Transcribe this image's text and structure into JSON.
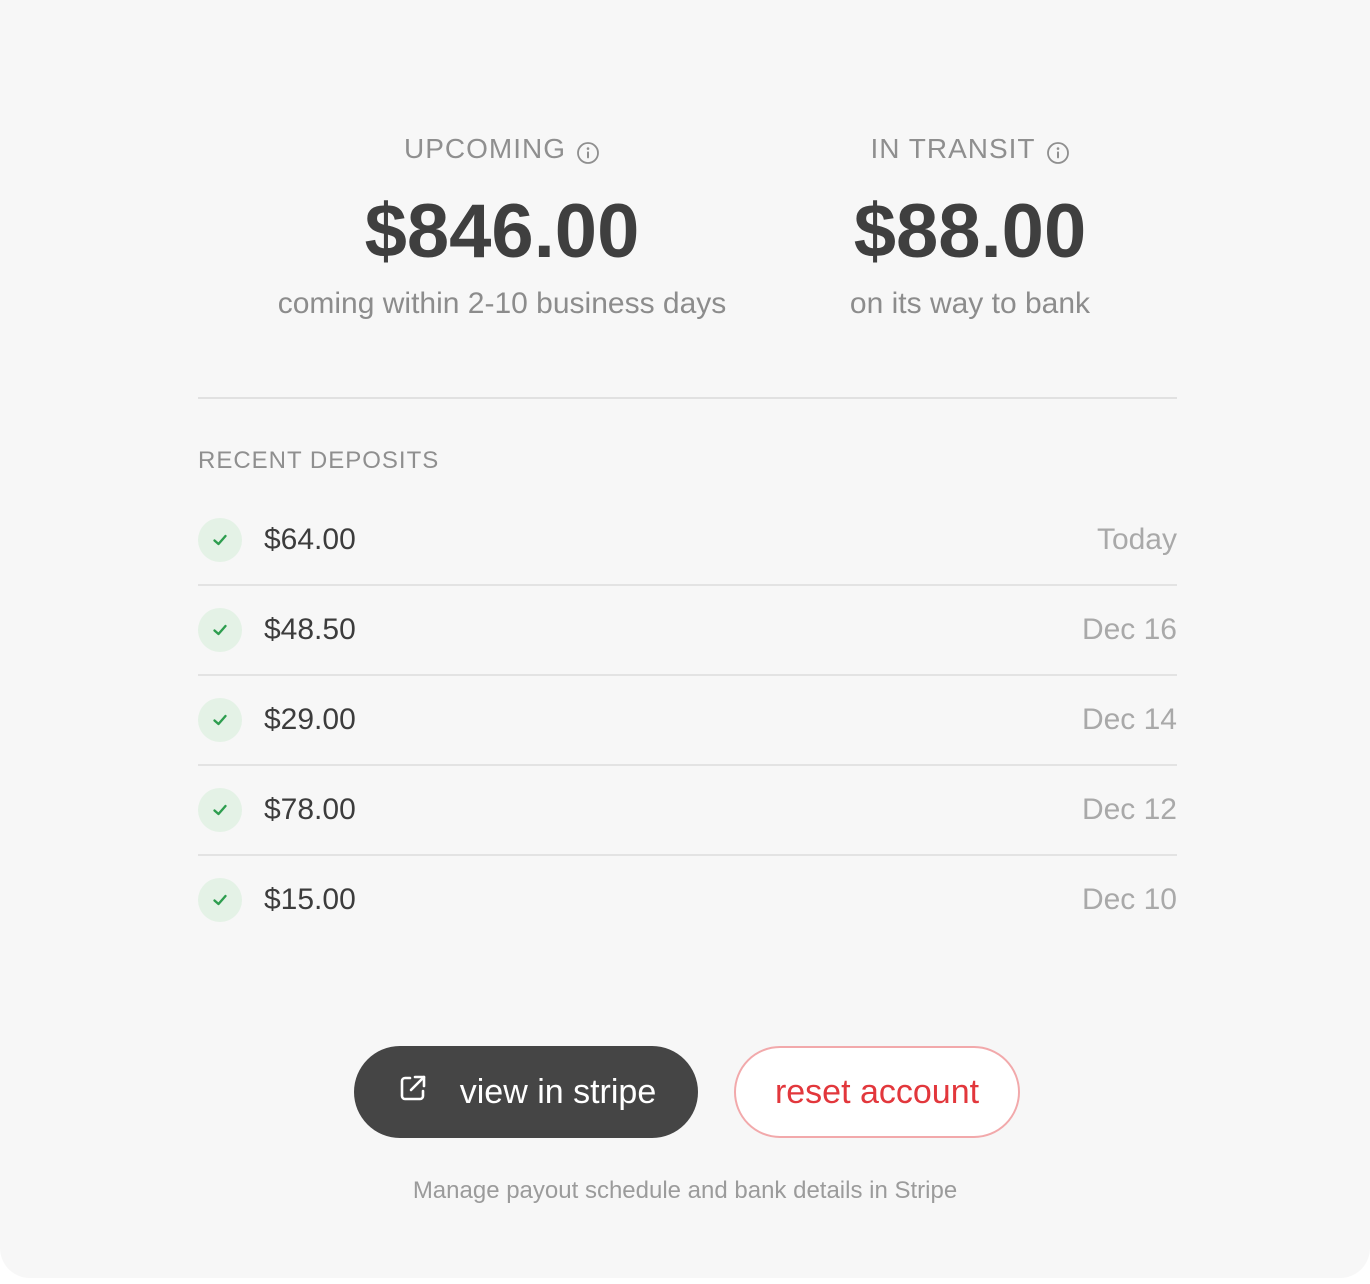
{
  "summary": {
    "upcoming": {
      "label": "UPCOMING",
      "amount": "$846.00",
      "subtitle": "coming within 2-10 business days"
    },
    "in_transit": {
      "label": "IN TRANSIT",
      "amount": "$88.00",
      "subtitle": "on its way to bank"
    }
  },
  "recent_deposits": {
    "title": "RECENT DEPOSITS",
    "items": [
      {
        "amount": "$64.00",
        "date": "Today",
        "status_icon": "check-icon"
      },
      {
        "amount": "$48.50",
        "date": "Dec 16",
        "status_icon": "check-icon"
      },
      {
        "amount": "$29.00",
        "date": "Dec 14",
        "status_icon": "check-icon"
      },
      {
        "amount": "$78.00",
        "date": "Dec 12",
        "status_icon": "check-icon"
      },
      {
        "amount": "$15.00",
        "date": "Dec 10",
        "status_icon": "check-icon"
      }
    ]
  },
  "actions": {
    "view_stripe_label": "view in stripe",
    "view_stripe_icon": "external-link-icon",
    "reset_label": "reset account"
  },
  "footnote": "Manage payout schedule and bank details in Stripe",
  "colors": {
    "success": "#2e9e4f",
    "success_bg": "#e4f2e6",
    "danger": "#e2373c",
    "primary_button": "#454545"
  }
}
